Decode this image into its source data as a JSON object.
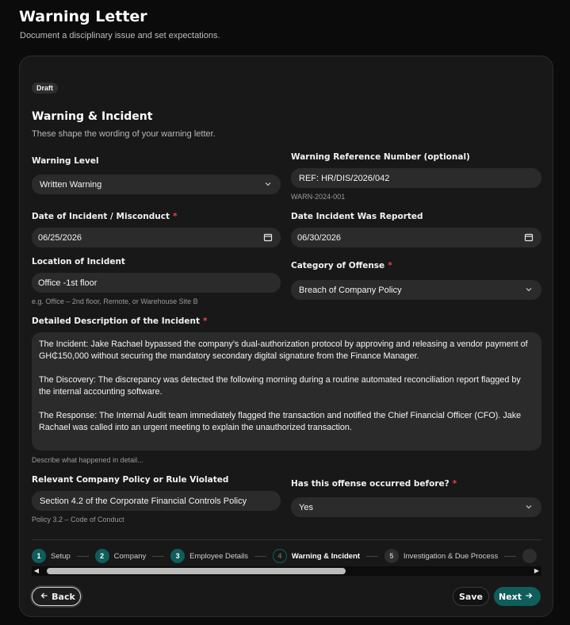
{
  "header": {
    "title": "Warning Letter",
    "subtitle": "Document a disciplinary issue and set expectations."
  },
  "badge": "Draft",
  "section": {
    "title": "Warning & Incident",
    "subtitle": "These shape the wording of your warning letter."
  },
  "fields": {
    "warning_level": {
      "label": "Warning Level",
      "value": "Written Warning"
    },
    "reference": {
      "label": "Warning Reference Number (optional)",
      "value": "REF: HR/DIS/2026/042",
      "hint": "WARN-2024-001"
    },
    "incident_date": {
      "label": "Date of Incident / Misconduct",
      "value": "06/25/2026"
    },
    "reported_date": {
      "label": "Date Incident Was Reported",
      "value": "06/30/2026"
    },
    "location": {
      "label": "Location of Incident",
      "value": "Office -1st floor",
      "hint": "e.g. Office – 2nd floor, Remote, or Warehouse Site B"
    },
    "category": {
      "label": "Category of Offense",
      "value": "Breach of Company Policy"
    },
    "description": {
      "label": "Detailed Description of the Incident",
      "paragraphs": [
        "The Incident: Jake Rachael bypassed the company's dual-authorization protocol by approving and releasing a vendor payment of GH₵150,000 without securing the mandatory secondary digital signature from the Finance Manager.",
        "The Discovery: The discrepancy was detected the following morning during a routine automated reconciliation report flagged by the internal accounting software.",
        "The Response: The Internal Audit team immediately flagged the transaction and notified the Chief Financial Officer (CFO). Jake Rachael was called into an urgent meeting to explain the unauthorized transaction."
      ],
      "hint": "Describe what happened in detail..."
    },
    "policy": {
      "label": "Relevant Company Policy or Rule Violated",
      "value": "Section 4.2 of the Corporate Financial Controls Policy",
      "hint": "Policy 3.2 – Code of Conduct"
    },
    "prior": {
      "label": "Has this offense occurred before?",
      "value": "Yes"
    }
  },
  "required_mark": "*",
  "steps": [
    {
      "num": "1",
      "label": "Setup",
      "state": "done"
    },
    {
      "num": "2",
      "label": "Company",
      "state": "done"
    },
    {
      "num": "3",
      "label": "Employee Details",
      "state": "done"
    },
    {
      "num": "4",
      "label": "Warning & Incident",
      "state": "current"
    },
    {
      "num": "5",
      "label": "Investigation & Due Process",
      "state": "todo"
    }
  ],
  "buttons": {
    "back": "Back",
    "save": "Save",
    "next": "Next"
  },
  "colors": {
    "accent": "#0f5e5b",
    "required": "#e0474c",
    "background": "#0b0b0b",
    "card": "#181818",
    "field": "#2b2b2b"
  },
  "icons": {
    "back": "arrow-left-icon",
    "next": "arrow-right-icon",
    "select": "chevron-down-icon",
    "date": "calendar-icon"
  }
}
